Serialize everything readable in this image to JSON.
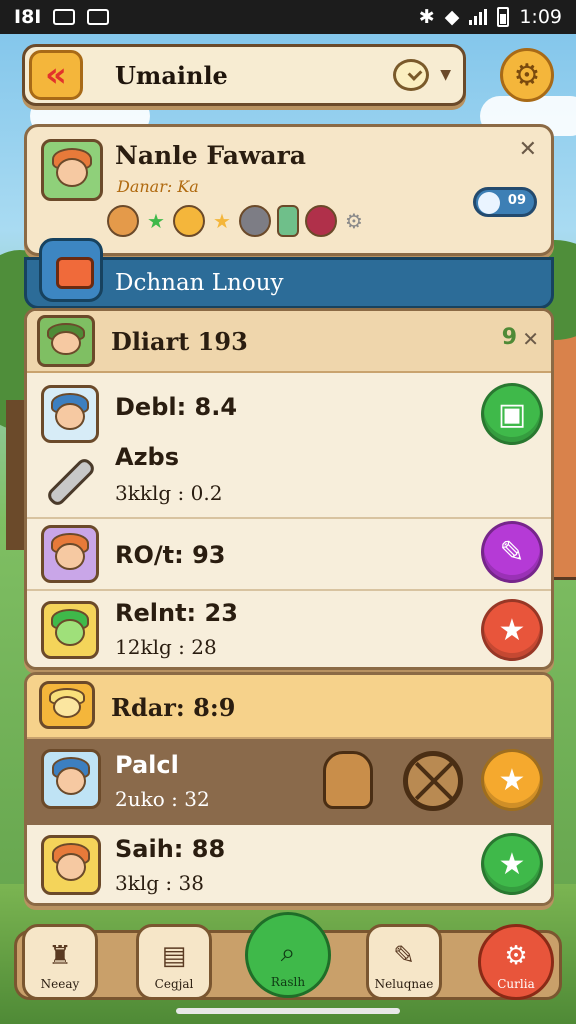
{
  "status_bar": {
    "left_text": "I8I",
    "time": "1:09"
  },
  "topbar": {
    "search_value": "Umainle",
    "back_icon": "back-arrow-icon",
    "gear_icon": "gear-icon"
  },
  "profile": {
    "name": "Nanle Fawara",
    "subtitle": "Danar: Ka",
    "toggle_label": "09",
    "badges": [
      "owl-badge",
      "star",
      "bird-badge",
      "star",
      "pig-badge",
      "gift-badge",
      "hero-badge",
      "gear-badge"
    ]
  },
  "banner": {
    "text": "Dchnan Lnouy"
  },
  "list_panel": {
    "title": "Dliart 193",
    "header_number": "9",
    "rows": [
      {
        "label": "Debl: 8.4",
        "stat": ""
      },
      {
        "label": "Azbs",
        "stat": "3kklg : 0.2"
      },
      {
        "label": "RO/t: 93",
        "stat": ""
      },
      {
        "label": "Relnt: 23",
        "stat": "12klg : 28"
      }
    ]
  },
  "panel2": {
    "title": "Rdar: 8:9",
    "rows": [
      {
        "label": "Palcl",
        "stat": "2uko : 32"
      },
      {
        "label": "Saih: 88",
        "stat": "3klg : 38"
      }
    ]
  },
  "bottom_nav": [
    {
      "label": "Neeay"
    },
    {
      "label": "Cegjal"
    },
    {
      "label": "Raslh"
    },
    {
      "label": "Neluqnae"
    },
    {
      "label": "Curlia"
    }
  ],
  "colors": {
    "accent_orange": "#f4b63b",
    "banner_blue": "#2c6c98",
    "action_green": "#3fb94a",
    "action_purple": "#b53ad6",
    "action_red": "#e8553b",
    "action_yellow": "#f5a92e"
  }
}
